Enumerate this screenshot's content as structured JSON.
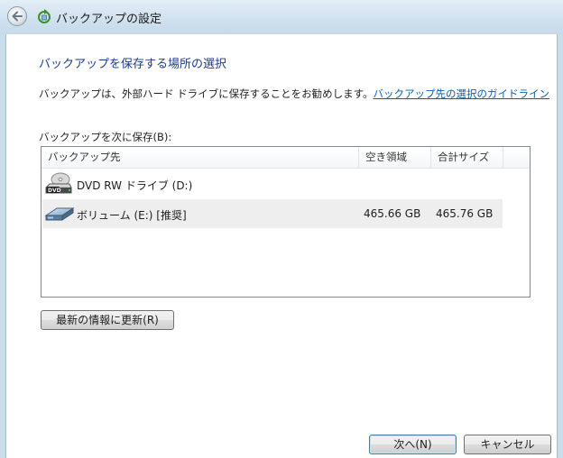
{
  "window": {
    "title": "バックアップの設定"
  },
  "page": {
    "heading": "バックアップを保存する場所の選択",
    "info_text": "バックアップは、外部ハード ドライブに保存することをお勧めします。",
    "info_link": "バックアップ先の選択のガイドライン",
    "save_label": "バックアップを次に保存(B):"
  },
  "list": {
    "columns": {
      "destination": "バックアップ先",
      "free_space": "空き領域",
      "total_size": "合計サイズ"
    },
    "rows": [
      {
        "name": "DVD RW ドライブ (D:)",
        "free": "",
        "total": "",
        "icon": "dvd-drive-icon",
        "selected": false
      },
      {
        "name": "ボリューム (E:) [推奨]",
        "free": "465.66 GB",
        "total": "465.76 GB",
        "icon": "hard-drive-icon",
        "selected": true
      }
    ]
  },
  "buttons": {
    "refresh": "最新の情報に更新(R)",
    "next": "次へ(N)",
    "cancel": "キャンセル"
  },
  "colors": {
    "heading": "#1e3b8f",
    "link": "#0b5fb3",
    "selected_row": "#eeeeee",
    "titlebar": "#cfe0ee"
  }
}
